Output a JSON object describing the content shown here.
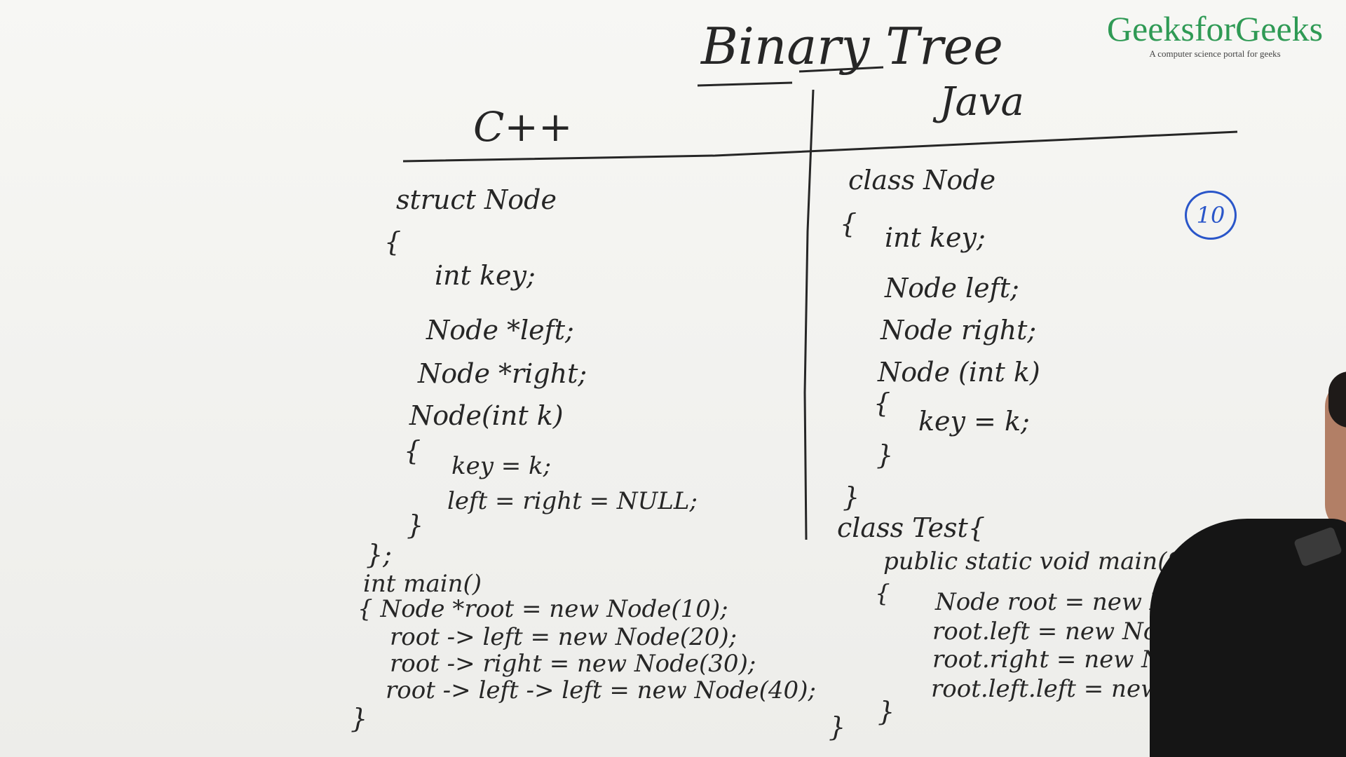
{
  "title": "Binary Tree",
  "logo": {
    "name": "GeeksforGeeks",
    "tagline": "A computer science portal for geeks"
  },
  "cpp": {
    "heading": "C++",
    "lines": [
      "struct Node",
      "{",
      "int key;",
      "Node *left;",
      "Node *right;",
      "Node(int k)",
      "{",
      "key = k;",
      "left = right = NULL;",
      "}",
      "};",
      "int main()",
      "{  Node *root = new Node(10);",
      "root -> left = new Node(20);",
      "root -> right = new Node(30);",
      "root -> left -> left = new Node(40);",
      "}"
    ]
  },
  "java": {
    "heading": "Java",
    "lines": [
      "class Node",
      "{",
      "int key;",
      "Node left;",
      "Node right;",
      "Node (int k)",
      "{",
      "key = k;",
      "}",
      "}",
      "class Test{",
      "public static void main(String [",
      "{",
      "Node root = new Node(10);",
      "root.left = new Node(2",
      "root.right = new Node(",
      "root.left.left = new N",
      "}",
      "}"
    ]
  },
  "circled_number": "10",
  "colors": {
    "ink": "#262626",
    "marker_blue": "#2a56c9",
    "logo_green": "#2f9a55"
  }
}
